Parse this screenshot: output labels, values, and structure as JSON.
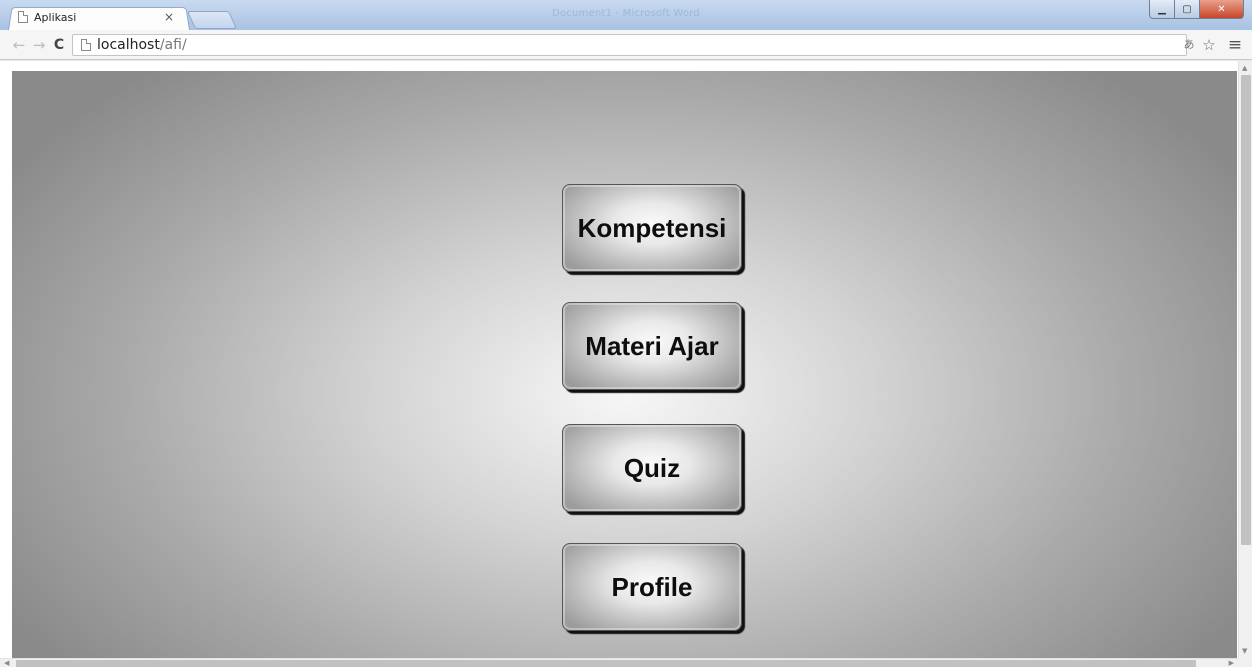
{
  "browser": {
    "window_title": "Document1 - Microsoft Word",
    "tab": {
      "title": "Aplikasi",
      "close": "×"
    },
    "address": {
      "host": "localhost",
      "path": "/afi/"
    },
    "icons": {
      "back": "arrow-left-icon",
      "forward": "arrow-right-icon",
      "reload": "reload-icon",
      "translate": "translate-icon",
      "bookmark": "star-icon",
      "menu": "hamburger-menu-icon"
    }
  },
  "menu": {
    "buttons": [
      {
        "label": "Kompetensi"
      },
      {
        "label": "Materi Ajar"
      },
      {
        "label": "Quiz"
      },
      {
        "label": "Profile"
      }
    ]
  },
  "colors": {
    "button_text": "#0e0e0e",
    "page_background_center": "#f7f7f7",
    "page_background_edge": "#8a8a8a"
  }
}
